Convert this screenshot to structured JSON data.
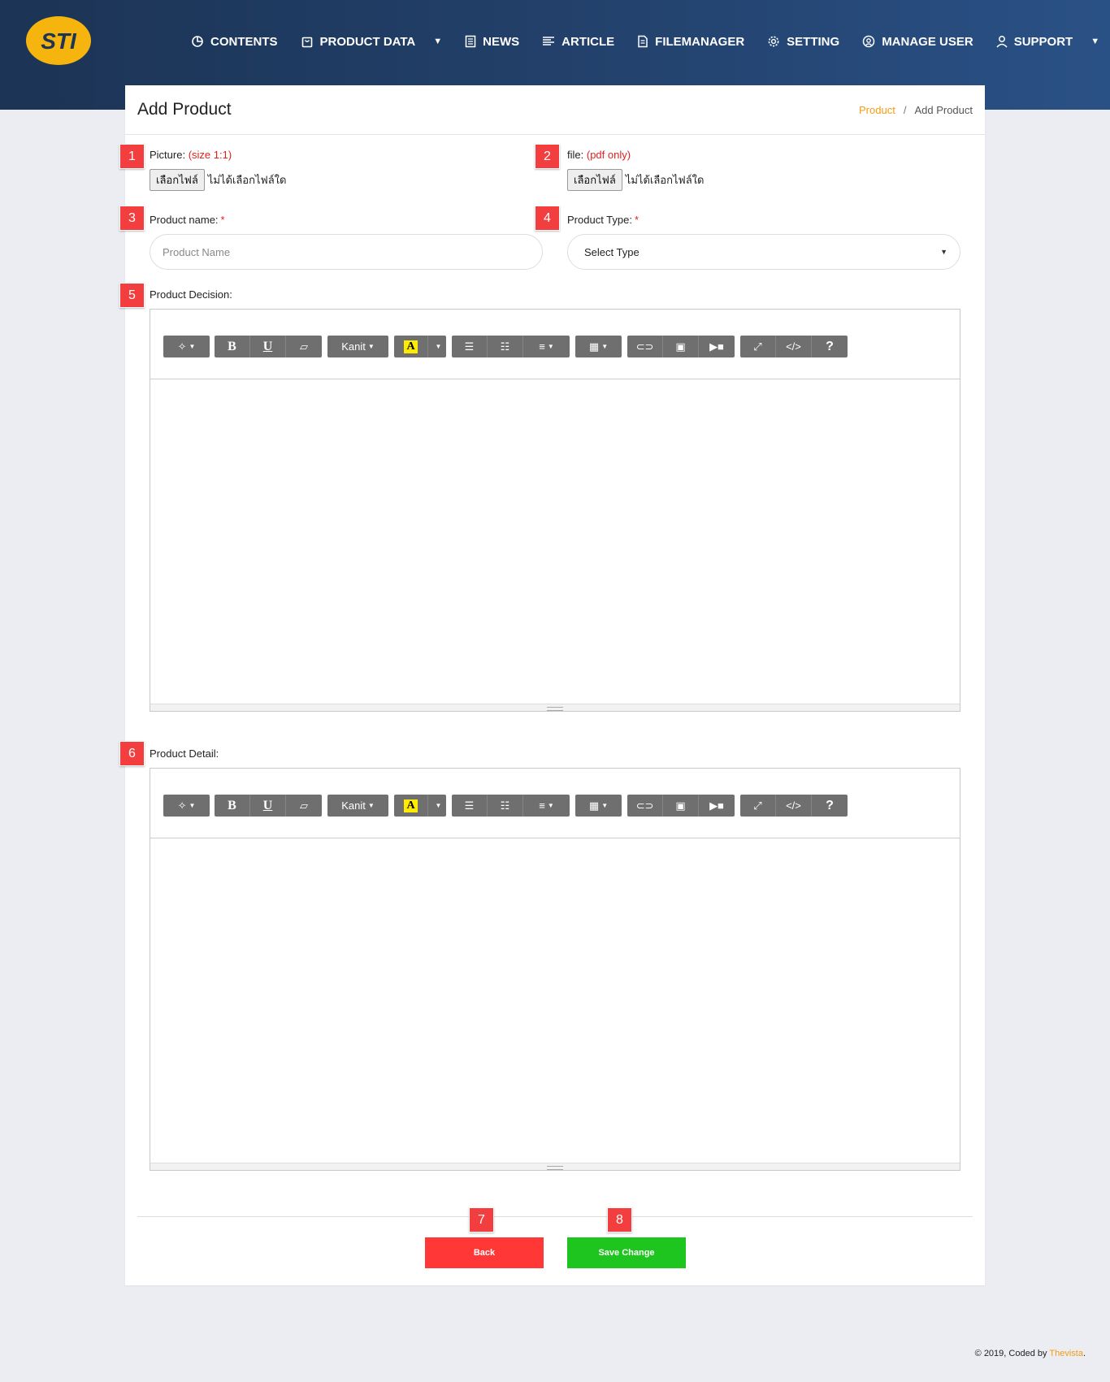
{
  "nav": {
    "logo_text": "STI",
    "items": [
      {
        "label": "CONTENTS",
        "icon": "pie-chart-icon"
      },
      {
        "label": "PRODUCT DATA",
        "icon": "bag-icon"
      },
      {
        "label": "NEWS",
        "icon": "document-icon"
      },
      {
        "label": "ARTICLE",
        "icon": "text-lines-icon"
      },
      {
        "label": "FILEMANAGER",
        "icon": "file-icon"
      },
      {
        "label": "SETTING",
        "icon": "gear-icon"
      },
      {
        "label": "MANAGE USER",
        "icon": "user-circle-icon"
      },
      {
        "label": "SUPPORT",
        "icon": "user-icon"
      }
    ]
  },
  "page": {
    "title": "Add Product",
    "breadcrumb": {
      "parent": "Product",
      "separator": "/",
      "current": "Add Product"
    }
  },
  "badges": [
    "1",
    "2",
    "3",
    "4",
    "5",
    "6",
    "7",
    "8"
  ],
  "form": {
    "picture": {
      "label": "Picture:",
      "hint": "(size 1:1)",
      "button": "เลือกไฟล์",
      "status": "ไม่ได้เลือกไฟล์ใด"
    },
    "file": {
      "label": "file:",
      "hint": "(pdf only)",
      "button": "เลือกไฟล์",
      "status": "ไม่ได้เลือกไฟล์ใด"
    },
    "product_name": {
      "label": "Product name:",
      "required": "*",
      "placeholder": "Product Name",
      "value": ""
    },
    "product_type": {
      "label": "Product Type:",
      "required": "*",
      "selected": "Select Type"
    },
    "decision": {
      "label": "Product Decision:"
    },
    "detail": {
      "label": "Product Detail:"
    }
  },
  "editor_toolbar": {
    "font": "Kanit",
    "highlight_letter": "A",
    "help": "?",
    "code": "</>"
  },
  "actions": {
    "back": "Back",
    "save": "Save Change"
  },
  "footer": {
    "text": "© 2019, Coded by",
    "brand": "Thevista",
    "suffix": "."
  },
  "colors": {
    "accent": "#f39c12",
    "badge": "#f23e3e",
    "back": "#ff3737",
    "save": "#1ec51e",
    "header": "#22406a"
  }
}
